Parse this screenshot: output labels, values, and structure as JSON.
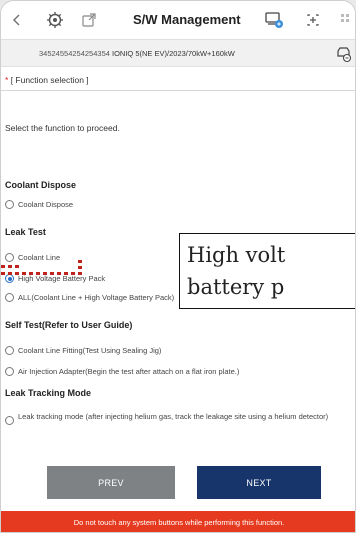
{
  "header": {
    "title": "S/W Management"
  },
  "vehicle": {
    "vin": "34524554254254354",
    "info": "IONIQ 5(NE EV)/2023/70kW+160kW"
  },
  "section_title": {
    "star": "*",
    "text": "[ Function selection ]"
  },
  "instruction": "Select the function to proceed.",
  "groups": {
    "coolant_dispose": {
      "title": "Coolant Dispose",
      "options": [
        "Coolant Dispose"
      ]
    },
    "leak_test": {
      "title": "Leak Test",
      "options": [
        "Coolant Line",
        "High Voltage Battery Pack",
        "ALL(Coolant Line + High Voltage Battery Pack)"
      ],
      "selected": "High Voltage Battery Pack"
    },
    "self_test": {
      "title": "Self Test(Refer to User Guide)",
      "options": [
        "Coolant Line Fitting(Test Using Sealing Jig)",
        "Air Injection Adapter(Begin the test after attach on a flat iron plate.)"
      ]
    },
    "leak_tracking": {
      "title": "Leak Tracking Mode",
      "options": [
        "Leak tracking mode (after injecting helium gas, track the leakage site using a helium detector)"
      ]
    }
  },
  "callout": {
    "line1": "High volt",
    "line2": "battery p"
  },
  "buttons": {
    "prev": "PREV",
    "next": "NEXT"
  },
  "warning": "Do not touch any system buttons while performing this function.",
  "colors": {
    "next_button": "#17346b",
    "prev_button": "#7e8284",
    "warning_bar": "#e53a1f",
    "selected_radio": "#2a6fc7",
    "pointer_dots": "#c0231b"
  },
  "icons": [
    "back-chevron-icon",
    "settings-gear-icon",
    "export-icon",
    "vehicle-ecu-icon",
    "add-window-icon",
    "grid-menu-icon",
    "vehicle-connect-icon"
  ]
}
